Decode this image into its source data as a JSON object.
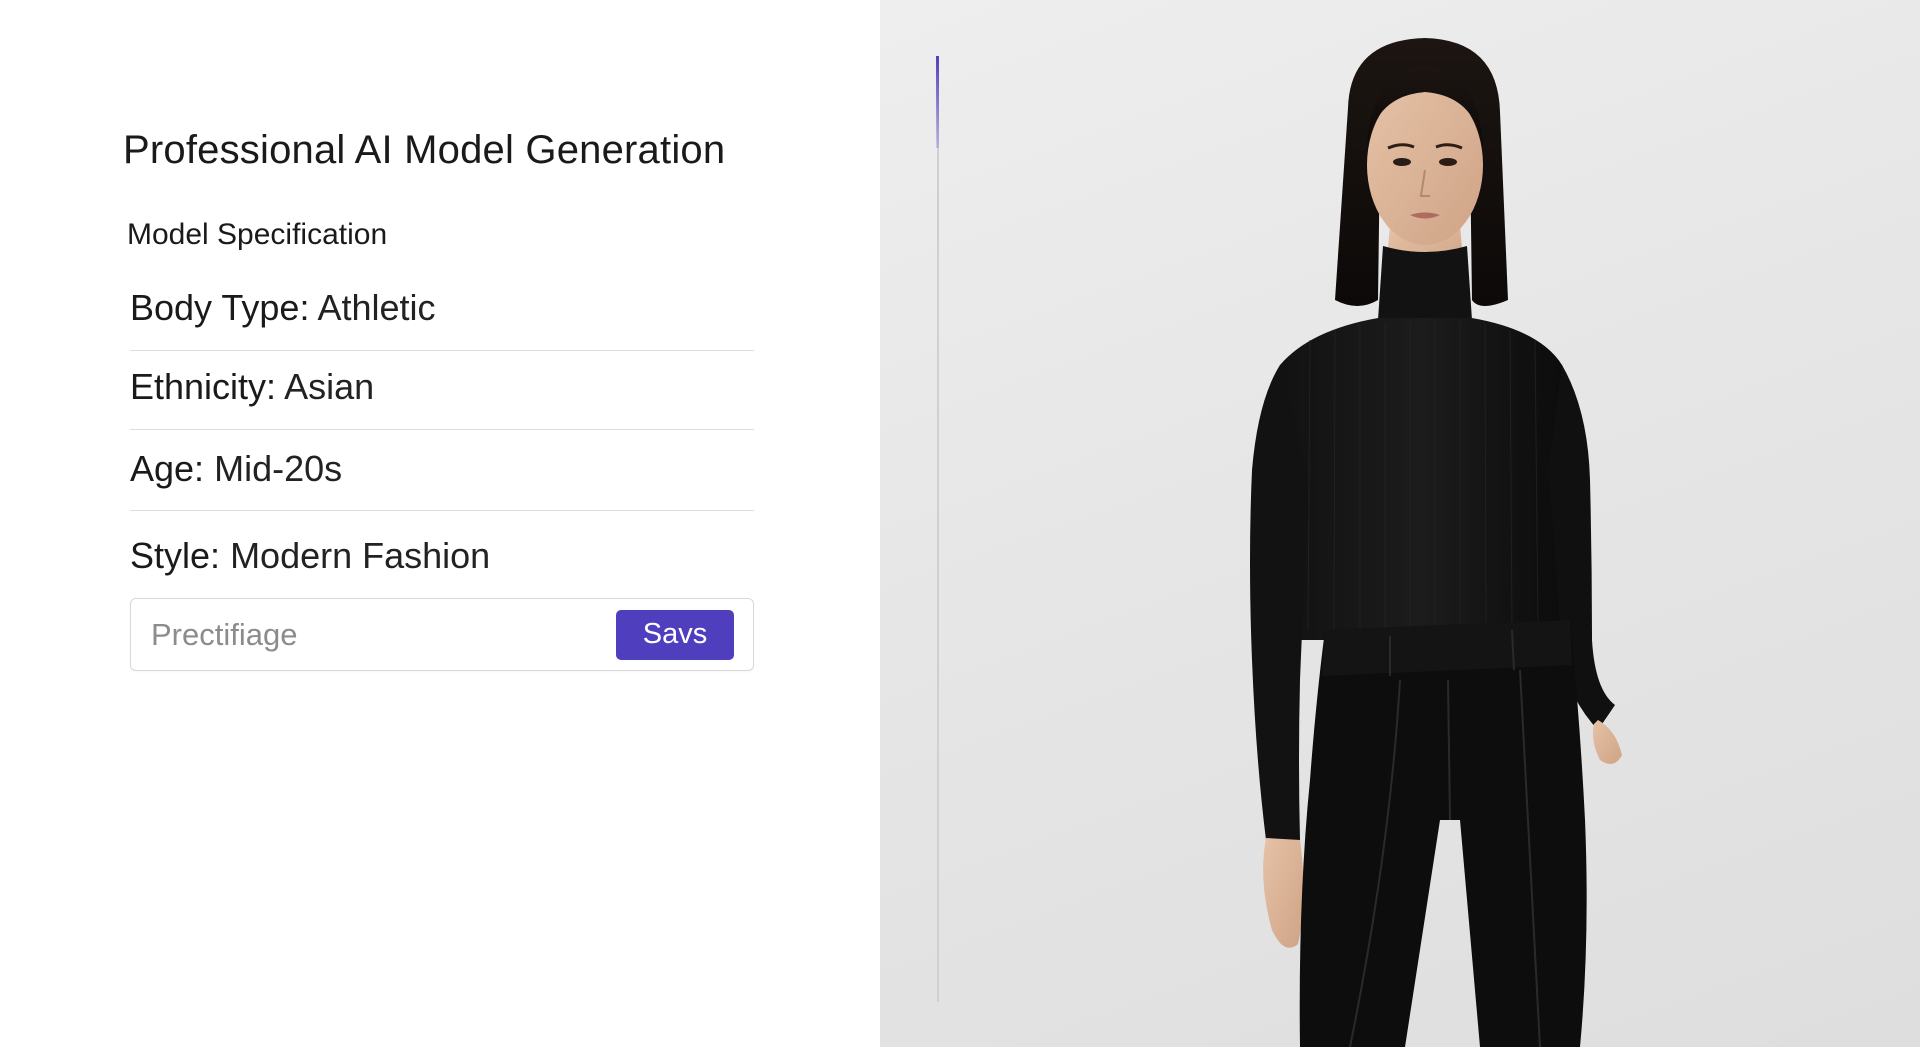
{
  "header": {
    "title": "Professional AI Model Generation"
  },
  "specification": {
    "section_label": "Model Specification",
    "rows": [
      {
        "key": "Body Type:",
        "value": "Athletic"
      },
      {
        "key": "Ethnicity:",
        "value": "Asian"
      },
      {
        "key": "Age:",
        "value": "Mid-20s"
      },
      {
        "key": "Style:",
        "value": "Modern Fashion"
      }
    ]
  },
  "prompt": {
    "placeholder": "Prectifiage",
    "value": ""
  },
  "actions": {
    "save_label": "Savs"
  },
  "colors": {
    "accent": "#4f3fbf",
    "divider": "#dedede",
    "preview_background": "#e6e6e6",
    "garment": "#0d0d0d"
  },
  "icons": {
    "preview": "model-preview-illustration"
  }
}
